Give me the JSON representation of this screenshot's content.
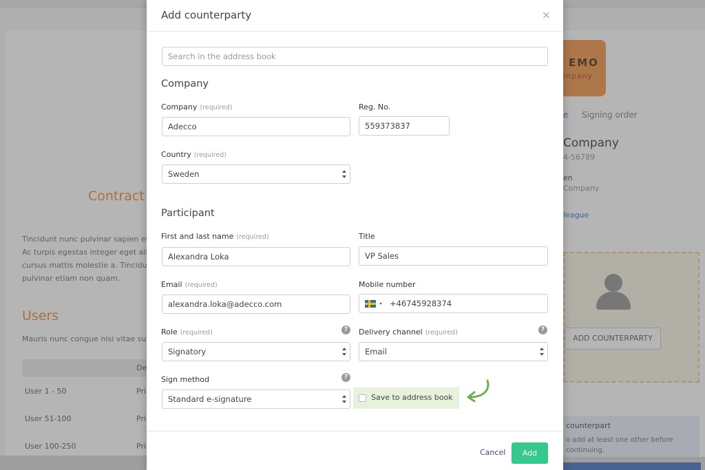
{
  "modal": {
    "title": "Add counterparty",
    "close_symbol": "×",
    "search_placeholder": "Search in the address book",
    "company_section": "Company",
    "company_label": "Company",
    "required_text": "(required)",
    "company_value": "Adecco",
    "regno_label": "Reg. No.",
    "regno_value": "559373837",
    "country_label": "Country",
    "country_value": "Sweden",
    "participant_section": "Participant",
    "name_label": "First and last name",
    "name_value": "Alexandra Loka",
    "title_label": "Title",
    "title_value": "VP Sales",
    "email_label": "Email",
    "email_value": "alexandra.loka@adecco.com",
    "mobile_label": "Mobile number",
    "mobile_value": "+46745928374",
    "role_label": "Role",
    "role_value": "Signatory",
    "delivery_label": "Delivery channel",
    "delivery_value": "Email",
    "sign_method_label": "Sign method",
    "sign_method_value": "Standard e-signature",
    "save_label": "Save to address book",
    "help_symbol": "?",
    "cancel_label": "Cancel",
    "add_label": "Add",
    "accent_color": "#35c98d",
    "highlight_color": "#e6f2dc",
    "arrow_color": "#6ab04c"
  },
  "background": {
    "contract_title": "Contract",
    "lorem": "Tincidunt nunc pulvinar sapien et Ac turpis egestas integer eget alic cursus mattis molestie a. Tincidun pulvinar etiam non quam.",
    "users_title": "Users",
    "users_sub": "Mauris nunc congue nisi vitae sus",
    "table_header": "De",
    "rows": [
      {
        "label": "User 1 - 50",
        "value": "Pri"
      },
      {
        "label": "User 51-100",
        "value": "Pri"
      },
      {
        "label": "User 100-250",
        "value": "Pri"
      }
    ],
    "logo_text": "EMO",
    "logo_sub": "mpany",
    "tab_partial": "e",
    "tab_signing_order": "Signing order",
    "company_name": "Company",
    "company_number": "4-56789",
    "person_partial": "en",
    "person_company": "Company",
    "colleague_link": "league",
    "add_counterparty": "ADD COUNTERPARTY",
    "notice_title": "counterpart",
    "notice_text": "o add at least one other before continuing."
  }
}
